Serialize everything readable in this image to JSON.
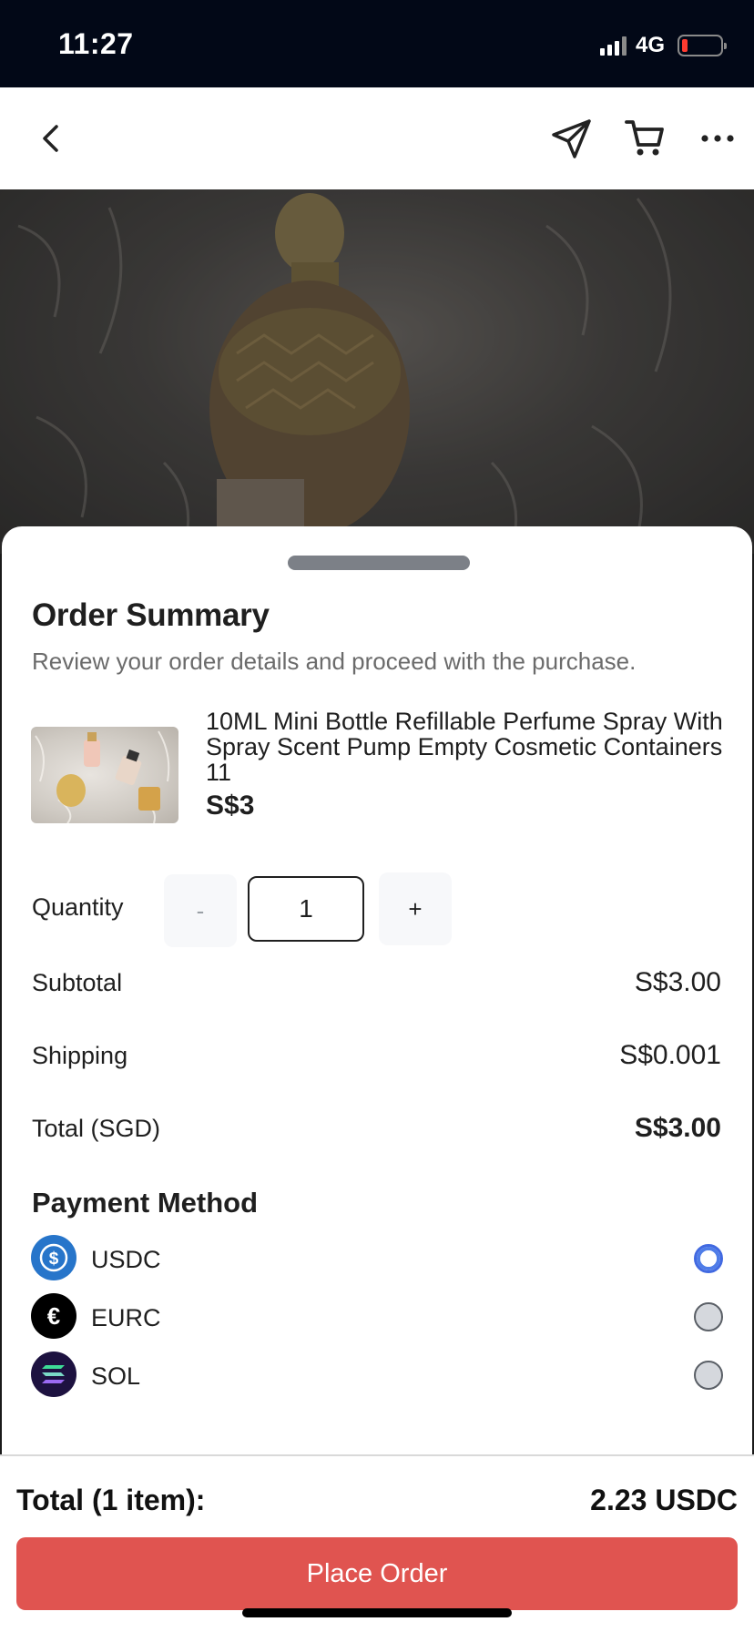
{
  "status_bar": {
    "time": "11:27",
    "network": "4G",
    "battery_level": 0.12,
    "battery_color": "#ff3b30"
  },
  "nav": {
    "back_icon": "chevron-left-icon",
    "share_icon": "send-icon",
    "cart_icon": "cart-icon",
    "more_icon": "more-horizontal-icon"
  },
  "order_summary": {
    "title": "Order Summary",
    "subtitle": "Review your order details and proceed with the purchase.",
    "product": {
      "name": "10ML Mini Bottle Refillable Perfume Spray With Spray Scent Pump Empty Cosmetic Containers 11",
      "price": "S$3"
    },
    "quantity": {
      "label": "Quantity",
      "decrement": "-",
      "value": "1",
      "increment": "+"
    },
    "subtotal": {
      "label": "Subtotal",
      "value": "S$3.00"
    },
    "shipping": {
      "label": "Shipping",
      "value": "S$0.001"
    },
    "total": {
      "label": "Total (SGD)",
      "value": "S$3.00"
    }
  },
  "payment": {
    "title": "Payment Method",
    "methods": [
      {
        "label": "USDC",
        "icon": "usdc-icon",
        "color": "#2775ca",
        "selected": true
      },
      {
        "label": "EURC",
        "icon": "euro-icon",
        "color": "#000000",
        "selected": false
      },
      {
        "label": "SOL",
        "icon": "solana-icon",
        "color": "#1d1240",
        "selected": false
      }
    ]
  },
  "footer": {
    "total_label": "Total (1 item):",
    "total_value": "2.23 USDC",
    "button_label": "Place Order",
    "button_color": "#e05450"
  }
}
